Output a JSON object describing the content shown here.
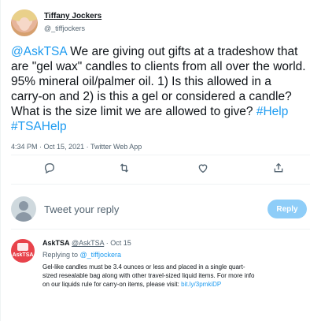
{
  "tweet": {
    "author_name": "Tiffany Jockers",
    "author_handle": "@_tiffjockers",
    "text_lines": [
      [
        {
          "t": "@AskTSA",
          "link": true
        },
        {
          "t": " We are giving out gifts at a tradeshow that"
        }
      ],
      [
        {
          "t": "are \"gel wax\" candles to clients from all over the world."
        }
      ],
      [
        {
          "t": "95% mineral oil/palmer oil.   1) Is this allowed in a"
        }
      ],
      [
        {
          "t": "carry-on and 2) is this a gel or considered a candle?"
        }
      ],
      [
        {
          "t": "What is the size limit we are allowed to give? "
        },
        {
          "t": "#Help",
          "link": true
        }
      ],
      [
        {
          "t": "#TSAHelp",
          "link": true
        }
      ]
    ],
    "time": "4:34 PM",
    "date": "Oct 15, 2021",
    "source": "Twitter Web App"
  },
  "actions": [
    "reply-icon",
    "retweet-icon",
    "like-icon",
    "share-icon"
  ],
  "compose": {
    "placeholder": "Tweet your reply",
    "button_label": "Reply"
  },
  "reply": {
    "name": "AskTSA",
    "handle": "@AskTSA",
    "date": "Oct 15",
    "avatar_label": "AskTSA",
    "replying_prefix": "Replying to ",
    "replying_to": "@_tiffjockera",
    "body_lines": [
      [
        {
          "t": "Gel-like candles must be 3.4 ounces or less and placed in a single quart-"
        }
      ],
      [
        {
          "t": "sized resealable bag along with other travel-sized liquid items. For more info"
        }
      ],
      [
        {
          "t": "on our liquids rule for carry-on items, please visit: "
        },
        {
          "t": "bit.ly/3pmkiDP",
          "link": true
        }
      ]
    ]
  },
  "colors": {
    "accent": "#1d9bf0",
    "reply_button": "#8ecdf8",
    "tsa_red": "#e8434b",
    "divider": "#eff3f4"
  }
}
